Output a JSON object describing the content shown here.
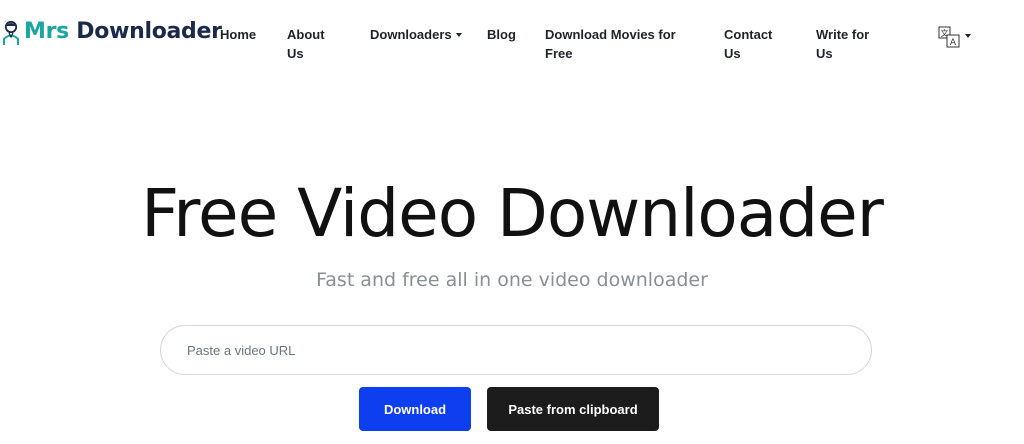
{
  "logo": {
    "part1": "Mrs",
    "part2": "Downloader"
  },
  "nav": {
    "home": "Home",
    "about": "About Us",
    "downloaders": "Downloaders",
    "blog": "Blog",
    "movies": "Download Movies for Free",
    "contact": "Contact Us",
    "write": "Write for Us",
    "language_icon": "translate-icon"
  },
  "hero": {
    "title": "Free Video Downloader",
    "subtitle": "Fast and free all in one video downloader"
  },
  "form": {
    "url_placeholder": "Paste a video URL",
    "url_value": "",
    "download_label": "Download",
    "paste_label": "Paste from clipboard"
  },
  "colors": {
    "brand_teal": "#1aa6a0",
    "brand_navy": "#1b2a4a",
    "primary_button": "#0d3ff0",
    "dark_button": "#1c1c1c"
  }
}
